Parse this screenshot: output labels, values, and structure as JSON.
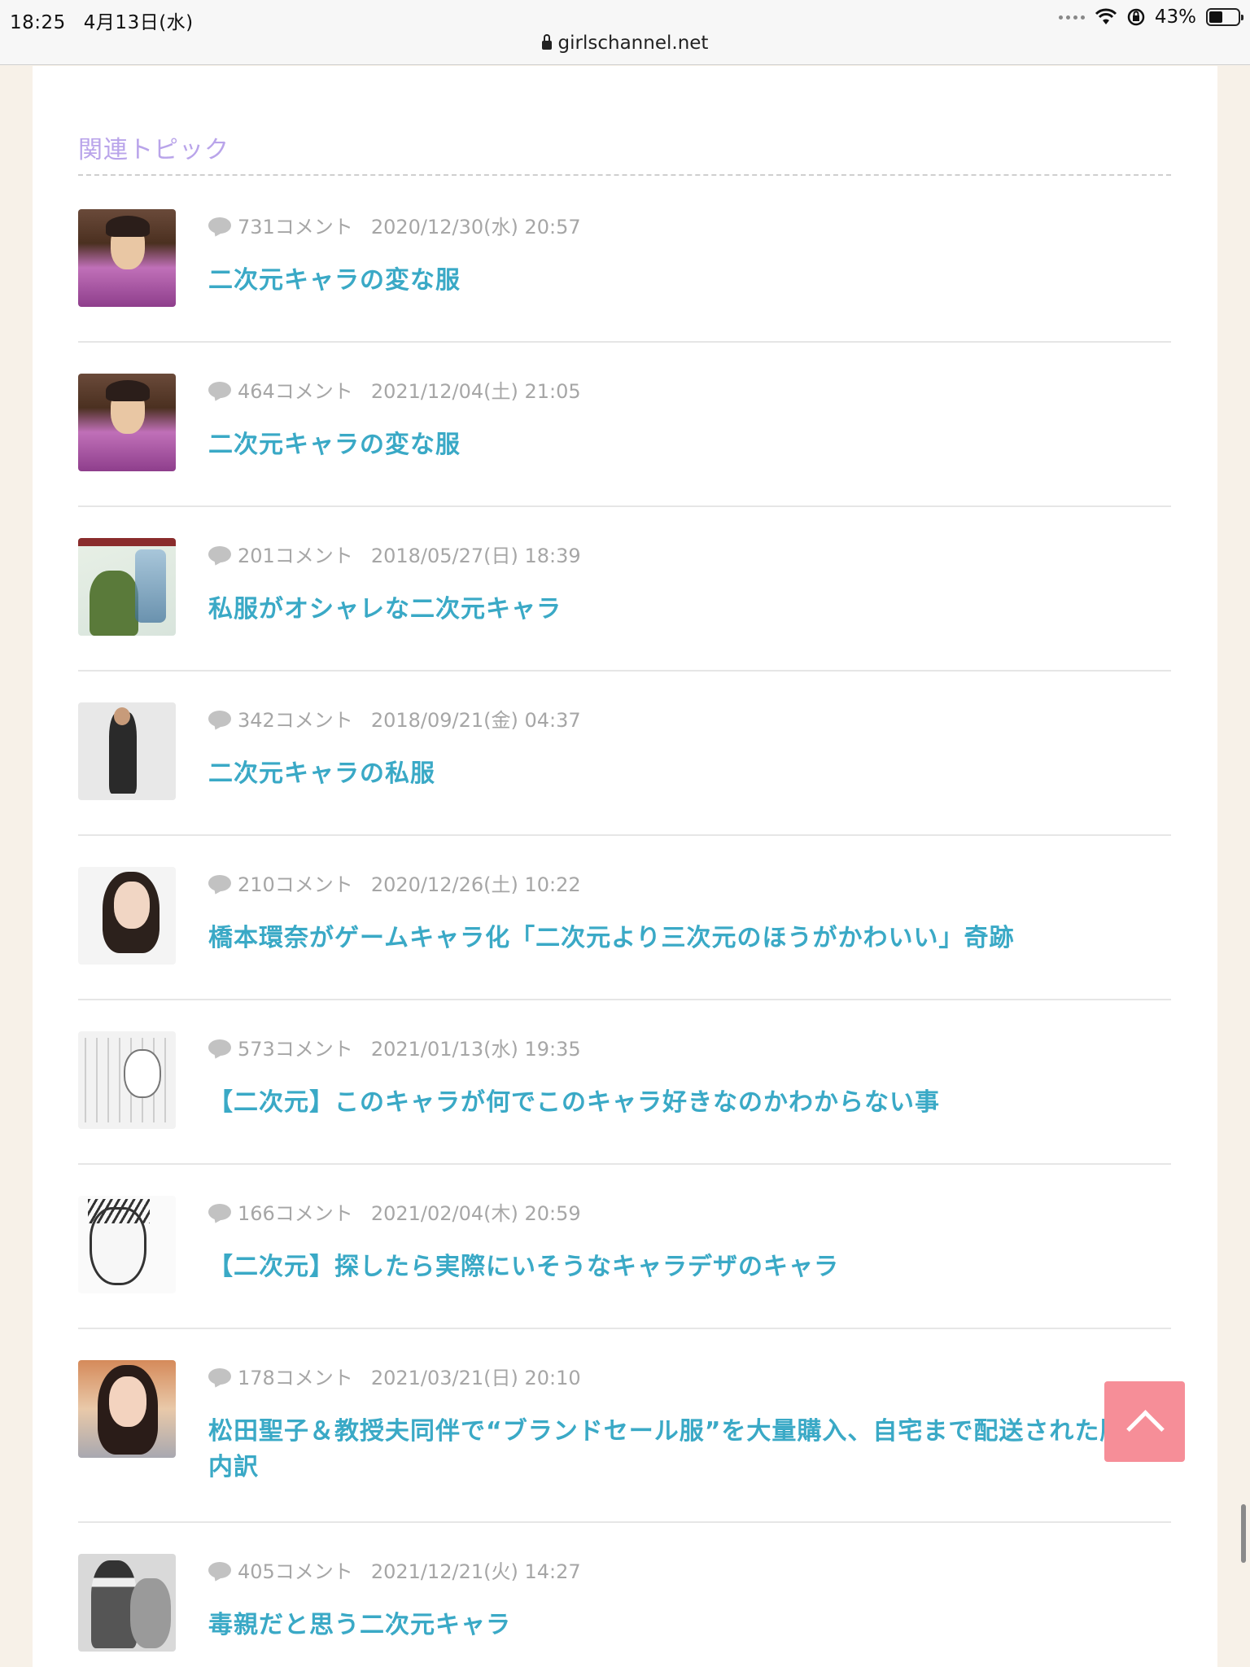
{
  "status_bar": {
    "time": "18:25",
    "date": "4月13日(水)",
    "battery": "43%",
    "battery_level": 0.43
  },
  "browser": {
    "url": "girlschannel.net"
  },
  "related": {
    "heading": "関連トピック",
    "topics": [
      {
        "comments": "731コメント",
        "date": "2020/12/30(水) 20:57",
        "title": "二次元キャラの変な服",
        "thumb": "anime-man-purple-shirt"
      },
      {
        "comments": "464コメント",
        "date": "2021/12/04(土) 21:05",
        "title": "二次元キャラの変な服",
        "thumb": "anime-man-purple-shirt"
      },
      {
        "comments": "201コメント",
        "date": "2018/05/27(日) 18:39",
        "title": "私服がオシャレな二次元キャラ",
        "thumb": "manga-cover"
      },
      {
        "comments": "342コメント",
        "date": "2018/09/21(金) 04:37",
        "title": "二次元キャラの私服",
        "thumb": "person-black-outfit"
      },
      {
        "comments": "210コメント",
        "date": "2020/12/26(土) 10:22",
        "title": "橋本環奈がゲームキャラ化「二次元より三次元のほうがかわいい」奇跡",
        "thumb": "woman-portrait"
      },
      {
        "comments": "573コメント",
        "date": "2021/01/13(水) 19:35",
        "title": "【二次元】このキャラが何でこのキャラ好きなのかわからない事",
        "thumb": "manga-page"
      },
      {
        "comments": "166コメント",
        "date": "2021/02/04(木) 20:59",
        "title": "【二次元】探したら実際にいそうなキャラデザのキャラ",
        "thumb": "manga-man-face"
      },
      {
        "comments": "178コメント",
        "date": "2021/03/21(日) 20:10",
        "title": "松田聖子＆教授夫同伴で“ブランドセール服”を大量購入、自宅まで配送された服の内訳",
        "thumb": "woman-smiling"
      },
      {
        "comments": "405コメント",
        "date": "2021/12/21(火) 14:27",
        "title": "毒親だと思う二次元キャラ",
        "thumb": "manga-panel"
      }
    ]
  },
  "icons": {
    "comment": "comment-bubble-icon",
    "back_to_top": "chevron-up-icon"
  },
  "colors": {
    "heading": "#b9a4ea",
    "topic_title": "#3aa9c6",
    "meta": "#a6a6a6",
    "back_to_top": "#f68e98",
    "page_bg": "#f7f1e8"
  }
}
